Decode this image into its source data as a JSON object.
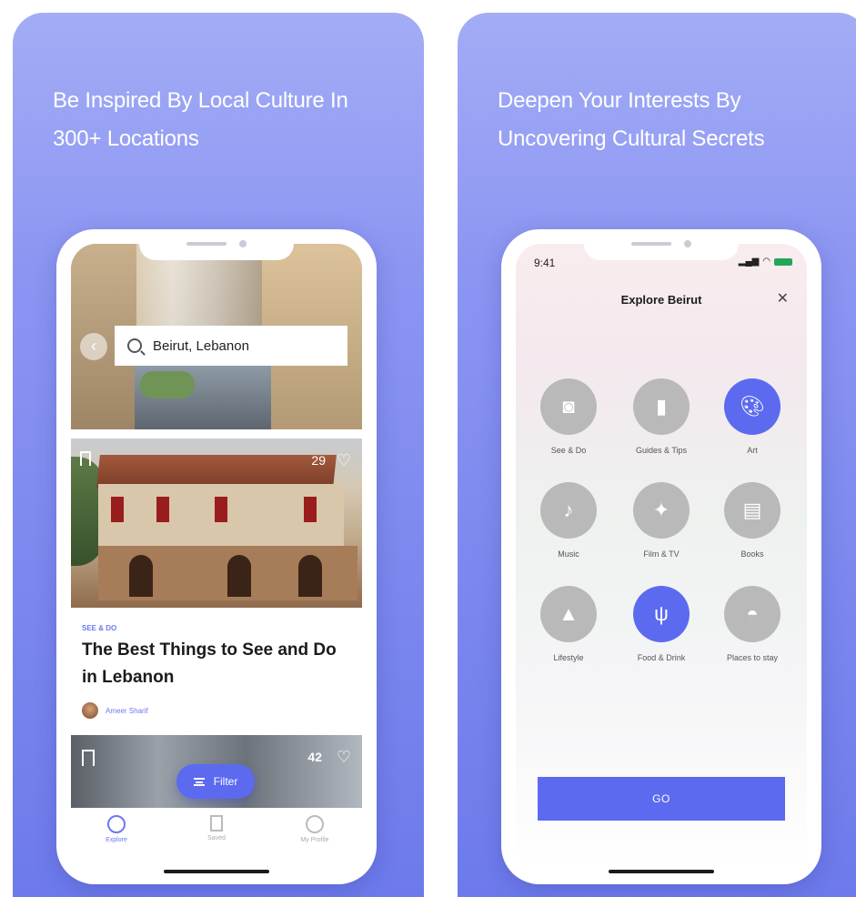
{
  "left_panel": {
    "headline": "Be Inspired By Local Culture In 300+ Locations",
    "search_text": "Beirut, Lebanon",
    "card": {
      "likes": "29",
      "category": "SEE & DO",
      "title": "The Best Things to See and Do in Lebanon",
      "author": "Ameer Sharif"
    },
    "strip_likes": "42",
    "filter_label": "Filter",
    "tabs": [
      {
        "label": "Explore",
        "icon": "globe-icon"
      },
      {
        "label": "Saved",
        "icon": "bookmark-icon"
      },
      {
        "label": "My Profile",
        "icon": "profile-icon"
      }
    ]
  },
  "right_panel": {
    "headline": "Deepen Your Interests By Uncovering Cultural Secrets",
    "status_time": "9:41",
    "title": "Explore Beirut",
    "categories": [
      {
        "label": "See & Do",
        "icon": "camera-icon",
        "selected": false
      },
      {
        "label": "Guides & Tips",
        "icon": "guide-icon",
        "selected": false
      },
      {
        "label": "Art",
        "icon": "palette-icon",
        "selected": true
      },
      {
        "label": "Music",
        "icon": "guitar-icon",
        "selected": false
      },
      {
        "label": "Film & TV",
        "icon": "film-icon",
        "selected": false
      },
      {
        "label": "Books",
        "icon": "book-icon",
        "selected": false
      },
      {
        "label": "Lifestyle",
        "icon": "lifestyle-icon",
        "selected": false
      },
      {
        "label": "Food & Drink",
        "icon": "cutlery-icon",
        "selected": true
      },
      {
        "label": "Places to stay",
        "icon": "cloche-icon",
        "selected": false
      }
    ],
    "go_label": "GO"
  },
  "colors": {
    "accent": "#5c6af0",
    "panel_bg": "#8b95f2",
    "inactive_circle": "#b9b9b9"
  }
}
